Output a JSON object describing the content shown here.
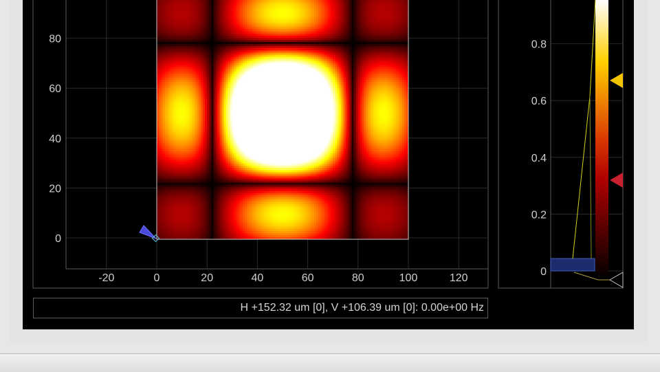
{
  "status": {
    "readout": "H +152.32 um [0], V +106.39 um [0]: 0.00e+00 Hz"
  },
  "colors": {
    "panel_background": "#000000",
    "frame_border": "#5a5a5a",
    "grid": "#2a2a2a",
    "tick_text": "#cfcfcf",
    "image_border": "#c8c8c8",
    "histogram_line": "#d4d41a",
    "histogram_bar": "#1e2a6e",
    "high_marker": "#f2c300",
    "low_marker": "#c8202e",
    "origin_marker": "#4a4ad8"
  },
  "icons": {
    "origin": "origin-marker-icon",
    "high": "high-level-arrow-icon",
    "low": "low-level-arrow-icon",
    "bottom": "black-level-arrow-icon"
  },
  "chart_data": [
    {
      "type": "heatmap",
      "colormap": "hot",
      "function": "sinc-squared 2D diffraction pattern",
      "x_ticks": [
        "-20",
        "0",
        "20",
        "40",
        "60",
        "80",
        "100",
        "120"
      ],
      "y_ticks": [
        "0",
        "20",
        "40",
        "60",
        "80"
      ],
      "xlim": [
        -37,
        132
      ],
      "ylim": [
        -12,
        100
      ],
      "image_extent": {
        "x": [
          0,
          100
        ],
        "y": [
          0,
          100
        ]
      },
      "center": [
        50,
        50
      ],
      "grid": true,
      "origin_marker": [
        0,
        0
      ]
    },
    {
      "type": "colorbar",
      "colormap": "hot",
      "y_ticks": [
        "0",
        "0.2",
        "0.4",
        "0.6",
        "0.8"
      ],
      "ylim": [
        -0.03,
        1
      ],
      "high_level": 0.67,
      "low_level": 0.32,
      "bottom_level": -0.03,
      "histogram_bar_level": 0.04,
      "grid": true
    }
  ]
}
